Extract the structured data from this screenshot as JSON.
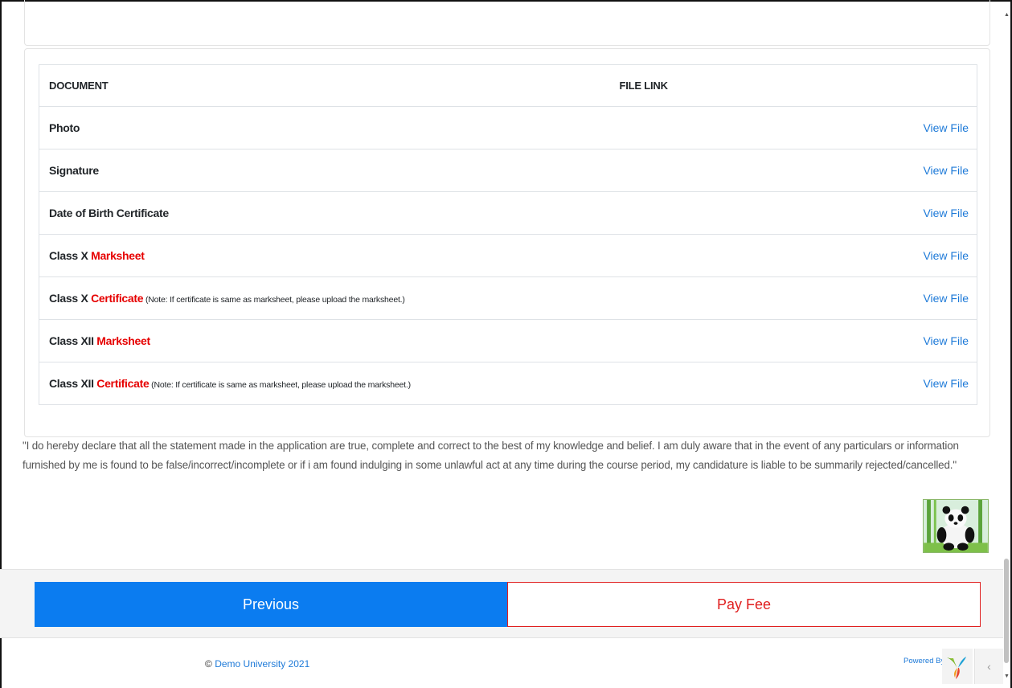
{
  "documents_table": {
    "headers": [
      "DOCUMENT",
      "FILE LINK"
    ],
    "rows": [
      {
        "prefix": "Photo",
        "highlight": "",
        "note": "",
        "link": "View File"
      },
      {
        "prefix": "Signature",
        "highlight": "",
        "note": "",
        "link": "View File"
      },
      {
        "prefix": "Date of Birth Certificate",
        "highlight": "",
        "note": "",
        "link": "View File"
      },
      {
        "prefix": "Class X ",
        "highlight": "Marksheet",
        "note": "",
        "link": "View File"
      },
      {
        "prefix": "Class X ",
        "highlight": "Certificate",
        "note": " (Note: If certificate is same as marksheet, please upload the marksheet.)",
        "link": "View File"
      },
      {
        "prefix": "Class XII ",
        "highlight": "Marksheet",
        "note": "",
        "link": "View File"
      },
      {
        "prefix": "Class XII ",
        "highlight": "Certificate",
        "note": " (Note: If certificate is same as marksheet, please upload the marksheet.)",
        "link": "View File"
      }
    ]
  },
  "declaration": "\"I do hereby declare that all the statement made in the application are true, complete and correct to the best of my knowledge and belief. I am duly aware that in the event of any particulars or information furnished by me is found to be false/incorrect/incomplete or if i am found indulging in some unlawful act at any time during the course period, my candidature is liable to be summarily rejected/cancelled.\"",
  "buttons": {
    "previous": "Previous",
    "pay_fee": "Pay Fee"
  },
  "footer": {
    "copyright_symbol": "©",
    "copyright_link": "Demo University 2021",
    "powered_by": "Powered By",
    "collapse_glyph": "‹"
  },
  "icons": {
    "signature_image": "panda-photo",
    "framework_logo": "yii-logo",
    "collapse": "chevron-left-icon"
  },
  "colors": {
    "primary": "#0b7cf0",
    "danger": "#e02020",
    "link": "#1e7ad8",
    "highlight_red": "#e60000"
  }
}
